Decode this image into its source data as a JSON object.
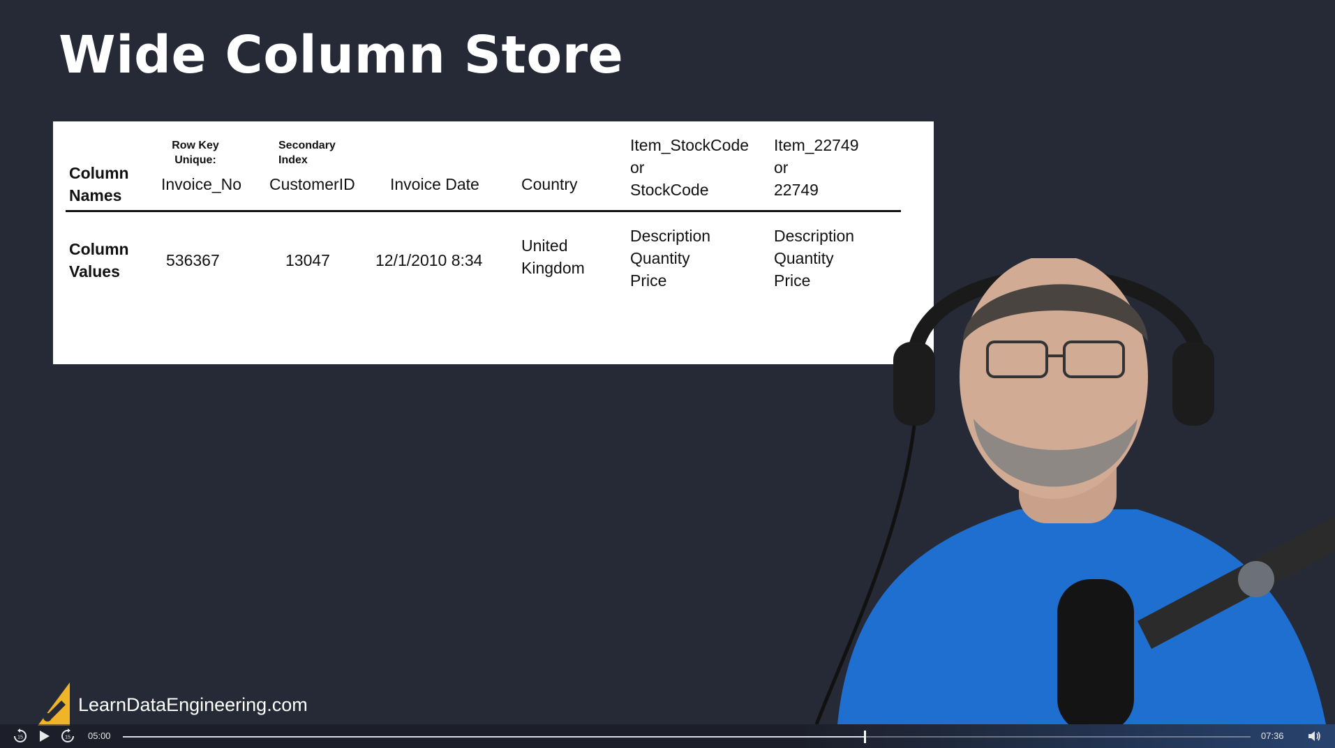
{
  "slide": {
    "title": "Wide Column Store",
    "row_labels": {
      "names_line1": "Column",
      "names_line2": "Names",
      "values_line1": "Column",
      "values_line2": "Values"
    },
    "annotations": {
      "row_key_line1": "Row Key",
      "row_key_line2": "Unique:",
      "secondary_line1": "Secondary",
      "secondary_line2": "Index"
    },
    "columns": [
      {
        "name": "Invoice_No",
        "value": "536367"
      },
      {
        "name": "CustomerID",
        "value": "13047"
      },
      {
        "name": "Invoice Date",
        "value": "12/1/2010 8:34"
      },
      {
        "name": "Country",
        "value_line1": "United",
        "value_line2": "Kingdom"
      },
      {
        "name_line1": "Item_StockCode",
        "name_line2": "or",
        "name_line3": "StockCode",
        "value_line1": "Description",
        "value_line2": "Quantity",
        "value_line3": "Price"
      },
      {
        "name_line1": "Item_22749",
        "name_line2": "or",
        "name_line3": "22749",
        "value_line1": "Description",
        "value_line2": "Quantity",
        "value_line3": "Price"
      }
    ]
  },
  "brand": {
    "text": "LearnDataEngineering.com",
    "logo_icon": "pencil-wrench-logo-icon",
    "logo_color": "#f0b429"
  },
  "player": {
    "current_time": "05:00",
    "duration": "07:36",
    "progress_percent": 65.8,
    "icons": [
      "rewind-15-icon",
      "play-icon",
      "forward-15-icon",
      "volume-icon"
    ]
  },
  "colors": {
    "background": "#262a37",
    "card": "#ffffff",
    "shirt": "#1f6fd1"
  }
}
